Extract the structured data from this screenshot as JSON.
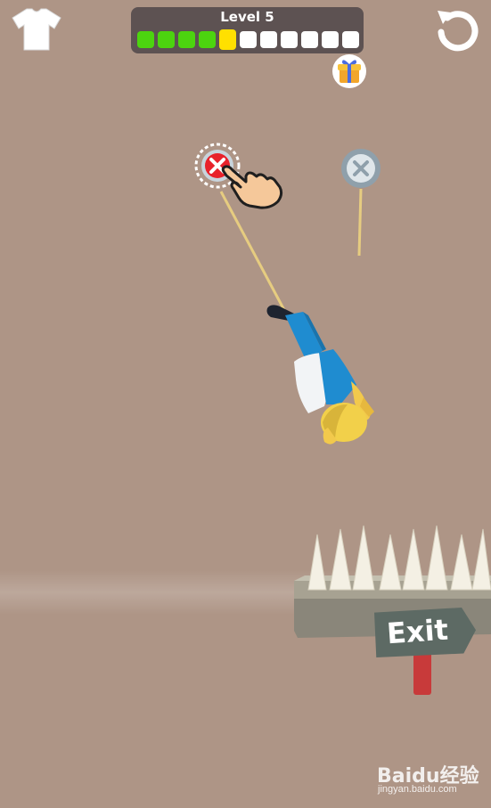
{
  "hud": {
    "level_label": "Level 5",
    "progress": {
      "total_steps": 11,
      "completed_steps": 4,
      "current_step": 5
    },
    "colors": {
      "done": "#4cd40f",
      "current": "#ffe000",
      "pending": "#ffffff",
      "panel": "#5d5252"
    }
  },
  "icons": {
    "shirt": "shirt-icon",
    "restart": "restart-icon",
    "gift": "gift-icon",
    "pin": "pin-cross-icon",
    "hand": "tap-hand-icon"
  },
  "pins": [
    {
      "id": "left",
      "state": "active-hint",
      "color": "#e8222b"
    },
    {
      "id": "right",
      "state": "idle",
      "color": "#9aa8b1"
    }
  ],
  "exit_sign": {
    "label": "Exit"
  },
  "watermark": {
    "logo": "Baidu经验",
    "url": "jingyan.baidu.com"
  }
}
